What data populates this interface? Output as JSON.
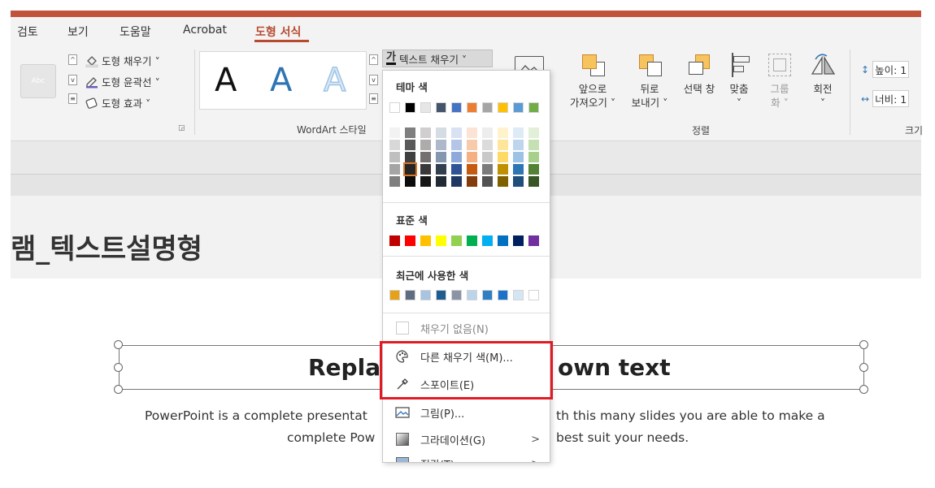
{
  "tabs": [
    "검토",
    "보기",
    "도움말",
    "Acrobat",
    "도형 서식"
  ],
  "ribbon": {
    "shape_style_sample": "Abc",
    "shape_fill": "도형 채우기 ˅",
    "shape_outline": "도형 윤곽선 ˅",
    "shape_effects": "도형 효과 ˅",
    "wordart_label": "WordArt 스타일",
    "wordart_letter": "A",
    "text_fill_button": "텍스트 채우기 ˅",
    "text_fill_glyph": "가",
    "arrange": {
      "bring_forward": [
        "앞으로",
        "가져오기 ˅"
      ],
      "send_backward": [
        "뒤로",
        "보내기 ˅"
      ],
      "selection_pane": [
        "선택 창"
      ],
      "align": [
        "맞춤",
        "˅"
      ],
      "group": [
        "그룹",
        "화 ˅"
      ],
      "rotate": [
        "회전",
        "˅"
      ],
      "label": "정렬"
    },
    "size": {
      "height": "높이: 1",
      "width": "너비: 1",
      "label": "크기"
    }
  },
  "slide": {
    "title_fragment": "램_텍스트설명형",
    "box_title_left": "Repla",
    "box_title_right": "own text",
    "body_line1_left": "PowerPoint is a complete presentat",
    "body_line1_right": "th this many slides you are able to make a",
    "body_line2_left": "complete Pow",
    "body_line2_right": "best suit your needs."
  },
  "menu": {
    "theme_colors_label": "테마 색",
    "standard_colors_label": "표준 색",
    "recent_colors_label": "최근에 사용한 색",
    "no_fill": "채우기 없음(N)",
    "more_fill_colors": "다른 채우기 색(M)...",
    "eyedropper": "스포이트(E)",
    "picture": "그림(P)...",
    "gradient": "그라데이션(G)",
    "texture": "질감(T)",
    "submenu_arrow": ">",
    "theme_row": [
      "#ffffff",
      "#000000",
      "#e7e6e6",
      "#44546a",
      "#4472c4",
      "#ed7d31",
      "#a5a5a5",
      "#ffc000",
      "#5b9bd5",
      "#70ad47"
    ],
    "theme_palette": [
      [
        "#f2f2f2",
        "#7f7f7f",
        "#d0cece",
        "#d6dce4",
        "#d9e2f3",
        "#fbe4d5",
        "#ededed",
        "#fff2cc",
        "#deebf6",
        "#e2efd9"
      ],
      [
        "#d8d8d8",
        "#595959",
        "#aeabab",
        "#adb9ca",
        "#b4c6e7",
        "#f7caac",
        "#dbdbdb",
        "#ffe599",
        "#bdd6ee",
        "#c5e0b3"
      ],
      [
        "#bfbfbf",
        "#3f3f3f",
        "#757070",
        "#8496b0",
        "#8eaadb",
        "#f4b083",
        "#c9c9c9",
        "#ffd966",
        "#9cc3e5",
        "#a8d08d"
      ],
      [
        "#a5a5a5",
        "#262626",
        "#3a3838",
        "#323f4f",
        "#2f5496",
        "#c55a11",
        "#7b7b7b",
        "#bf9000",
        "#2e75b5",
        "#538135"
      ],
      [
        "#7f7f7f",
        "#0c0c0c",
        "#171616",
        "#222a35",
        "#1f3763",
        "#833c0b",
        "#525252",
        "#7f6000",
        "#1e4e79",
        "#375623"
      ]
    ],
    "standard_row": [
      "#c00000",
      "#ff0000",
      "#ffc000",
      "#ffff00",
      "#92d050",
      "#00b050",
      "#00b0f0",
      "#0070c0",
      "#002060",
      "#7030a0"
    ],
    "recent_row": [
      "#e6a118",
      "#5f6d82",
      "#a7c4e0",
      "#1f5c8f",
      "#8a94a6",
      "#bcd4ea",
      "#2f7fc4",
      "#1a73c8",
      "#d4e5f3",
      "#ffffff"
    ]
  },
  "colors": {
    "accent": "#b84a30",
    "highlight": "#e01b24"
  }
}
